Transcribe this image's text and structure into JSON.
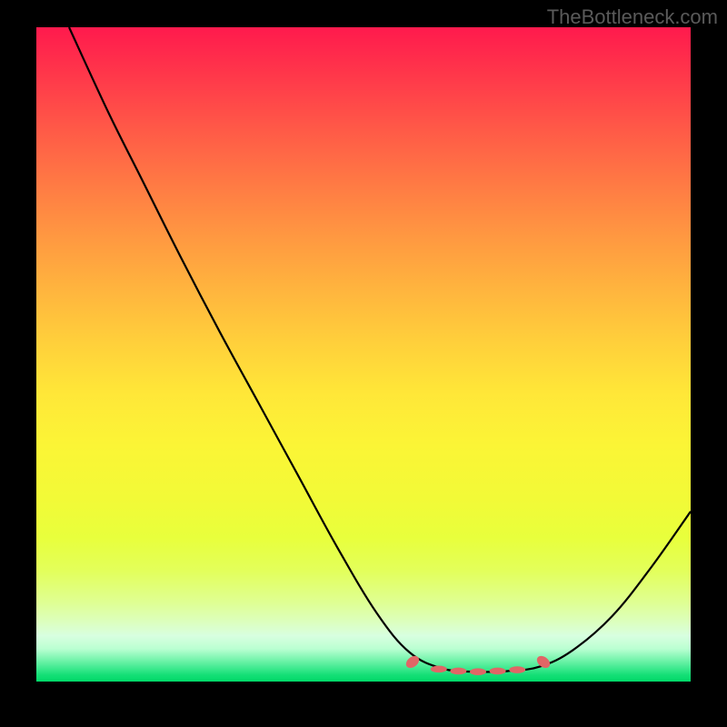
{
  "watermark": "TheBottleneck.com",
  "chart_data": {
    "type": "line",
    "title": "",
    "xlabel": "",
    "ylabel": "",
    "xlim": [
      0,
      100
    ],
    "ylim": [
      0,
      100
    ],
    "curve_points": [
      {
        "x": 5.0,
        "y": 100.0
      },
      {
        "x": 11.0,
        "y": 87.0
      },
      {
        "x": 16.0,
        "y": 77.0
      },
      {
        "x": 22.0,
        "y": 65.0
      },
      {
        "x": 28.0,
        "y": 53.5
      },
      {
        "x": 34.0,
        "y": 42.5
      },
      {
        "x": 40.0,
        "y": 31.5
      },
      {
        "x": 46.0,
        "y": 20.5
      },
      {
        "x": 52.0,
        "y": 10.5
      },
      {
        "x": 57.0,
        "y": 4.5
      },
      {
        "x": 62.0,
        "y": 2.0
      },
      {
        "x": 67.0,
        "y": 1.5
      },
      {
        "x": 72.0,
        "y": 1.6
      },
      {
        "x": 77.0,
        "y": 2.3
      },
      {
        "x": 82.0,
        "y": 4.8
      },
      {
        "x": 88.0,
        "y": 10.0
      },
      {
        "x": 94.0,
        "y": 17.5
      },
      {
        "x": 100.0,
        "y": 26.0
      }
    ],
    "highlight_markers": [
      {
        "x": 57.5,
        "y": 3.0
      },
      {
        "x": 61.5,
        "y": 1.9
      },
      {
        "x": 64.5,
        "y": 1.6
      },
      {
        "x": 67.5,
        "y": 1.5
      },
      {
        "x": 70.5,
        "y": 1.6
      },
      {
        "x": 73.5,
        "y": 1.8
      },
      {
        "x": 77.5,
        "y": 3.0
      }
    ],
    "marker_color": "#e06666",
    "curve_color": "#000000",
    "gradient_stops": [
      {
        "pos": 0.0,
        "color": "#ff1a4d"
      },
      {
        "pos": 0.5,
        "color": "#ffd93b"
      },
      {
        "pos": 0.88,
        "color": "#e0ff90"
      },
      {
        "pos": 1.0,
        "color": "#00d968"
      }
    ]
  }
}
